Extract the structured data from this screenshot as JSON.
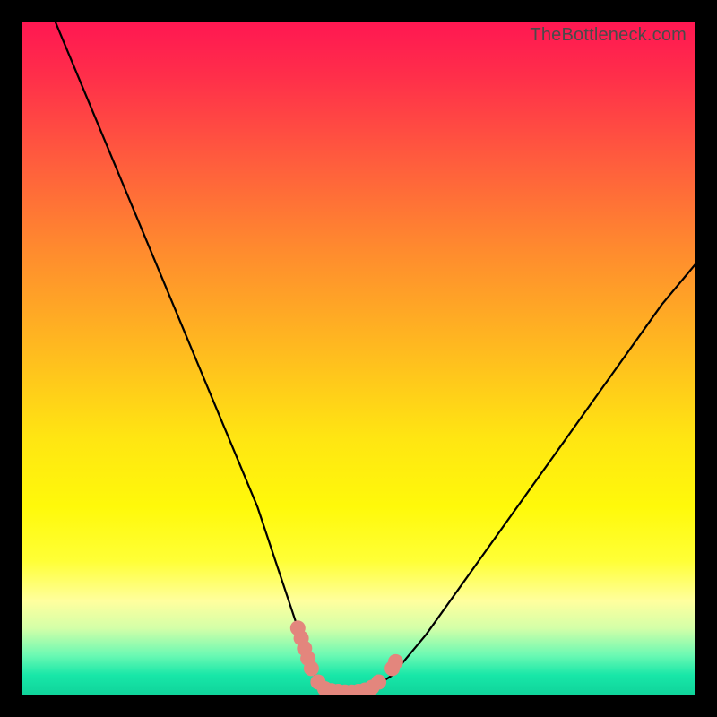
{
  "watermark": "TheBottleneck.com",
  "chart_data": {
    "type": "line",
    "title": "",
    "xlabel": "",
    "ylabel": "",
    "xlim": [
      0,
      100
    ],
    "ylim": [
      0,
      100
    ],
    "series": [
      {
        "name": "bottleneck-curve",
        "x": [
          5,
          10,
          15,
          20,
          25,
          30,
          35,
          40,
          41,
          42,
          43,
          44,
          45,
          46,
          47,
          48,
          50,
          52,
          55,
          60,
          65,
          70,
          75,
          80,
          85,
          90,
          95,
          100
        ],
        "y": [
          100,
          88,
          76,
          64,
          52,
          40,
          28,
          13,
          10,
          7,
          4,
          2,
          1,
          0.5,
          0.5,
          0.5,
          0.5,
          1,
          3,
          9,
          16,
          23,
          30,
          37,
          44,
          51,
          58,
          64
        ]
      }
    ],
    "markers": {
      "name": "highlight-range",
      "color": "#e3867d",
      "points": [
        {
          "x": 41.0,
          "y": 10.0
        },
        {
          "x": 41.5,
          "y": 8.5
        },
        {
          "x": 42.0,
          "y": 7.0
        },
        {
          "x": 42.5,
          "y": 5.5
        },
        {
          "x": 43.0,
          "y": 4.0
        },
        {
          "x": 44.0,
          "y": 2.0
        },
        {
          "x": 45.0,
          "y": 1.0
        },
        {
          "x": 46.0,
          "y": 0.7
        },
        {
          "x": 47.0,
          "y": 0.6
        },
        {
          "x": 48.0,
          "y": 0.5
        },
        {
          "x": 49.0,
          "y": 0.5
        },
        {
          "x": 50.0,
          "y": 0.6
        },
        {
          "x": 51.0,
          "y": 0.8
        },
        {
          "x": 52.0,
          "y": 1.2
        },
        {
          "x": 53.0,
          "y": 2.0
        },
        {
          "x": 55.0,
          "y": 4.0
        },
        {
          "x": 55.5,
          "y": 5.0
        }
      ]
    },
    "gradient_stops": [
      {
        "pos": 0.0,
        "color": "#ff1752"
      },
      {
        "pos": 0.2,
        "color": "#ff5a3e"
      },
      {
        "pos": 0.48,
        "color": "#ffb820"
      },
      {
        "pos": 0.72,
        "color": "#fff90a"
      },
      {
        "pos": 0.86,
        "color": "#ffff9e"
      },
      {
        "pos": 0.94,
        "color": "#6cf9b3"
      },
      {
        "pos": 1.0,
        "color": "#0fd39a"
      }
    ]
  }
}
